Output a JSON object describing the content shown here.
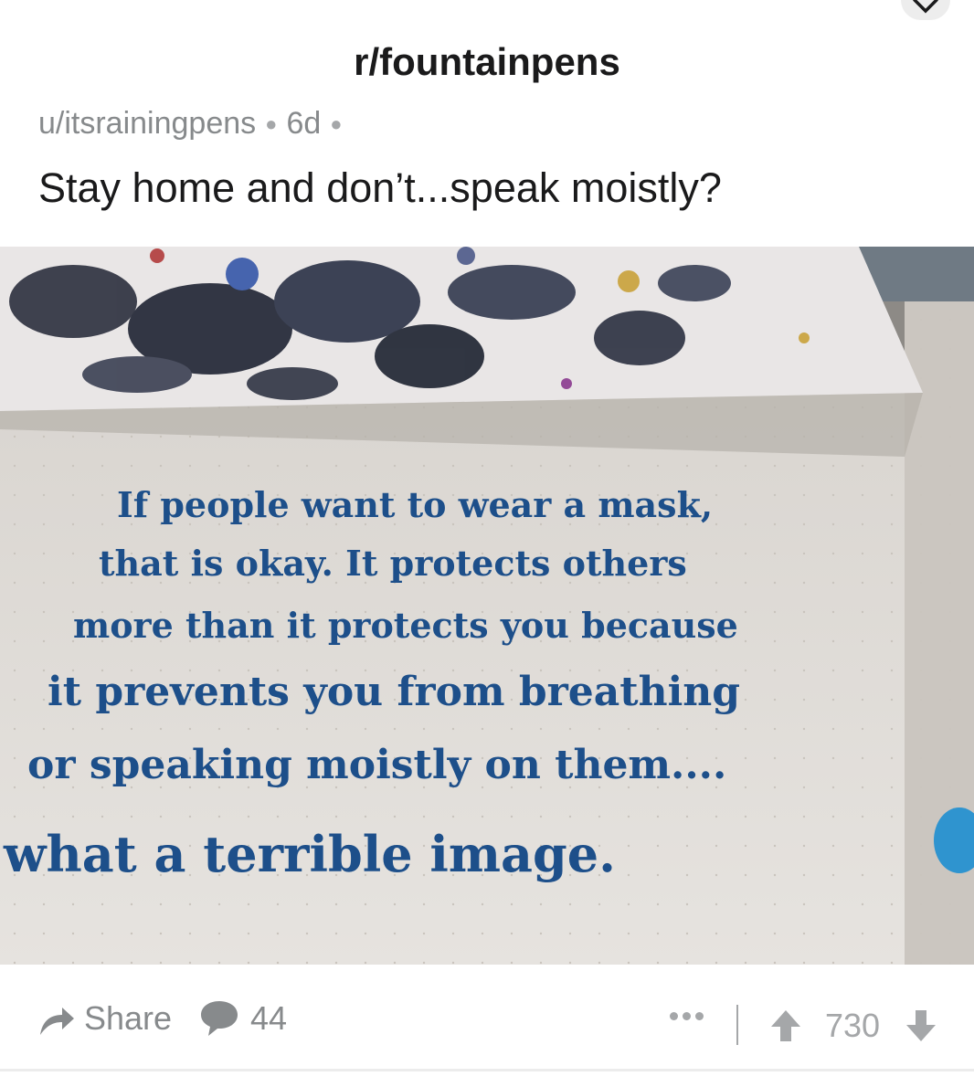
{
  "post": {
    "subreddit": "r/fountainpens",
    "author": "u/itsrainingpens",
    "age": "6d",
    "title": "Stay home and don’t...speak moistly?",
    "image_text_lines": [
      "If people want to wear a mask,",
      "that is okay. It protects others",
      "more than it protects you because",
      "it prevents you from breathing",
      "or speaking moistly on them....",
      "what a terrible image."
    ]
  },
  "actions": {
    "share_label": "Share",
    "comment_count": "44",
    "score": "730"
  },
  "icons": {
    "close": "close-icon",
    "share": "share-arrow-icon",
    "comment": "comment-bubble-icon",
    "more": "more-dots-icon",
    "upvote": "upvote-arrow-icon",
    "downvote": "downvote-arrow-icon"
  },
  "colors": {
    "ink": "#1d4f8a",
    "meta_gray": "#878a8c",
    "text": "#1a1a1b"
  }
}
